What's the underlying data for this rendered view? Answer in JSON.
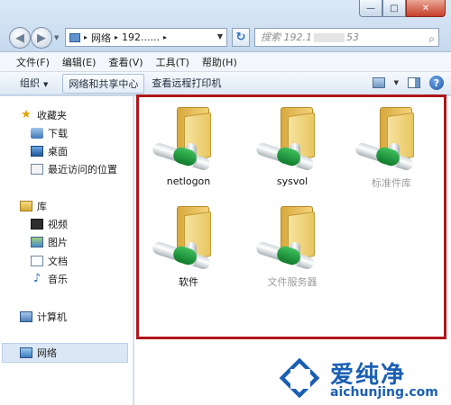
{
  "window": {
    "minimize_glyph": "—",
    "maximize_glyph": "□",
    "close_glyph": "✕"
  },
  "address": {
    "crumbs": [
      "网络",
      "192......"
    ],
    "separator": "▸"
  },
  "search": {
    "text_start": "搜索 192.1",
    "text_end": "53"
  },
  "menu": [
    "文件(F)",
    "编辑(E)",
    "查看(V)",
    "工具(T)",
    "帮助(H)"
  ],
  "commands": {
    "organize": "组织",
    "network_center": "网络和共享中心",
    "printers": "查看远程打印机"
  },
  "sidebar": {
    "favorites": {
      "header": "收藏夹",
      "items": [
        "下载",
        "桌面",
        "最近访问的位置"
      ]
    },
    "libraries": {
      "header": "库",
      "items": [
        "视频",
        "图片",
        "文档",
        "音乐"
      ]
    },
    "computer": "计算机",
    "network": "网络"
  },
  "shares": [
    {
      "label": "netlogon"
    },
    {
      "label": "sysvol"
    },
    {
      "label": "标准件库"
    },
    {
      "label": "软件"
    },
    {
      "label": "文件服务器"
    }
  ],
  "watermark": {
    "brand_cn": "爱纯净",
    "url": "aichunjing.com"
  },
  "colors": {
    "highlight_border": "#b0161b",
    "brand": "#1a5fb4"
  }
}
